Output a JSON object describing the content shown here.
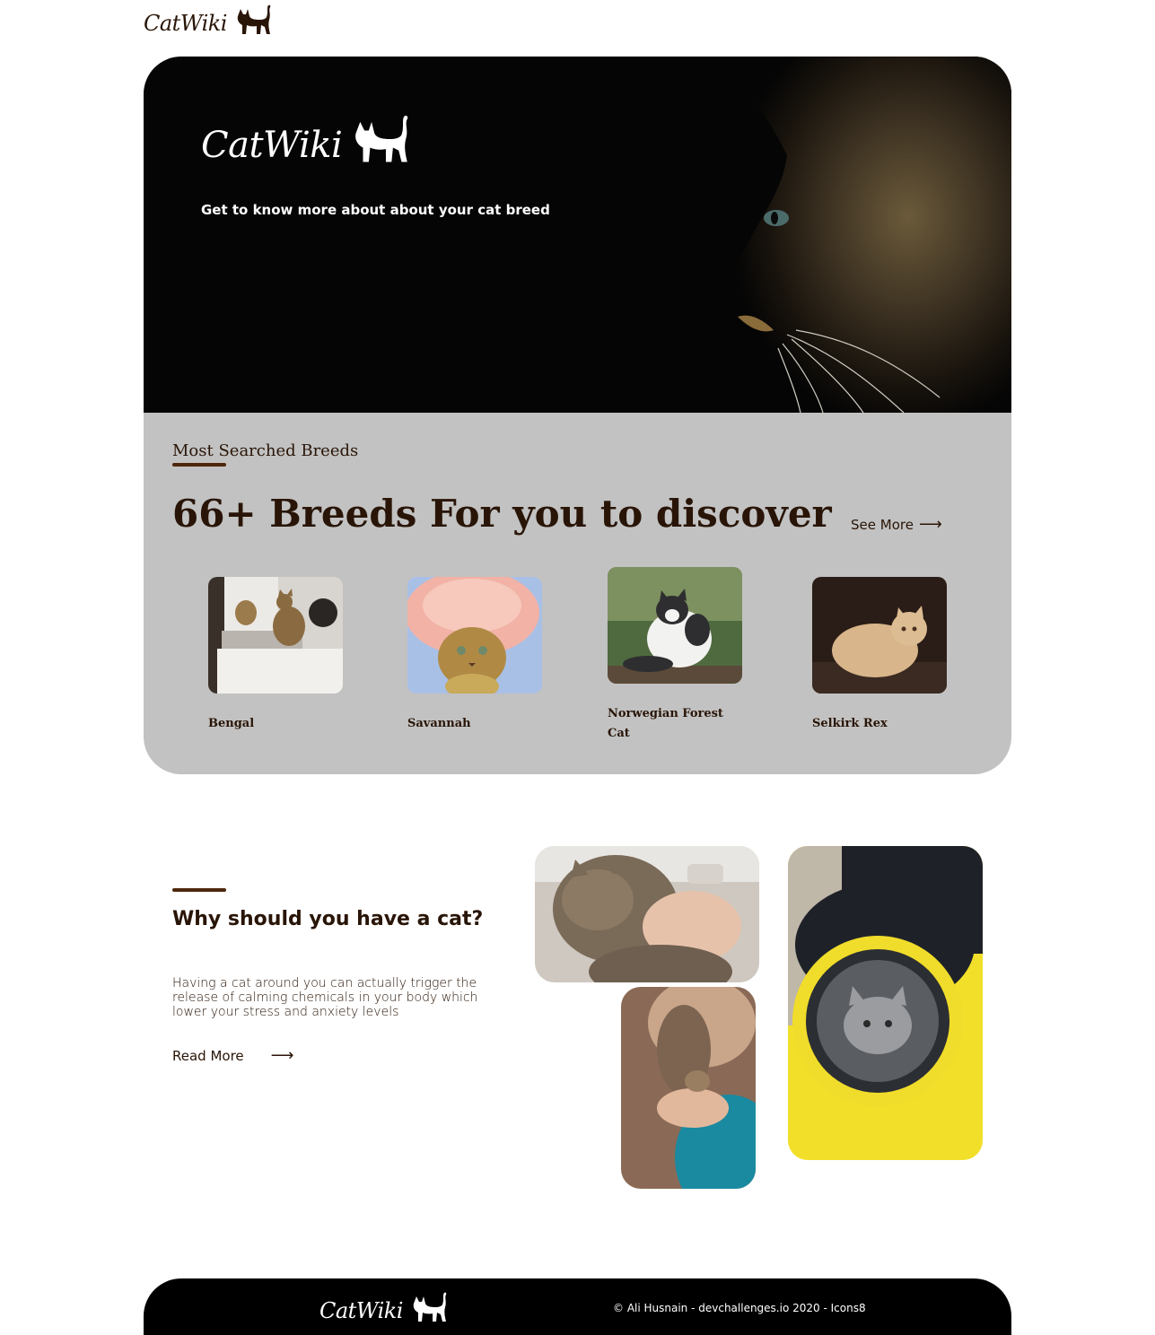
{
  "brand": {
    "name": "CatWiki"
  },
  "hero": {
    "tagline": "Get to know more about about your cat breed"
  },
  "breeds": {
    "label": "Most Searched Breeds",
    "heading": "66+ Breeds For you to discover",
    "see_more": "See More",
    "arrow": "⟶",
    "items": [
      {
        "name": "Bengal"
      },
      {
        "name": "Savannah"
      },
      {
        "name": "Norwegian Forest Cat"
      },
      {
        "name": "Selkirk Rex"
      }
    ]
  },
  "why": {
    "title": "Why should you have a cat?",
    "text": "Having a cat around you can actually trigger the release of calming chemicals in your body which lower your stress and anxiety levels",
    "read_more": "Read More",
    "arrow": "⟶"
  },
  "footer": {
    "copyright": "© Ali Husnain - devchallenges.io 2020 - Icons8"
  },
  "colors": {
    "brand_dark": "#291507",
    "accent": "#4d270c",
    "panel": "#c2c2c2"
  }
}
